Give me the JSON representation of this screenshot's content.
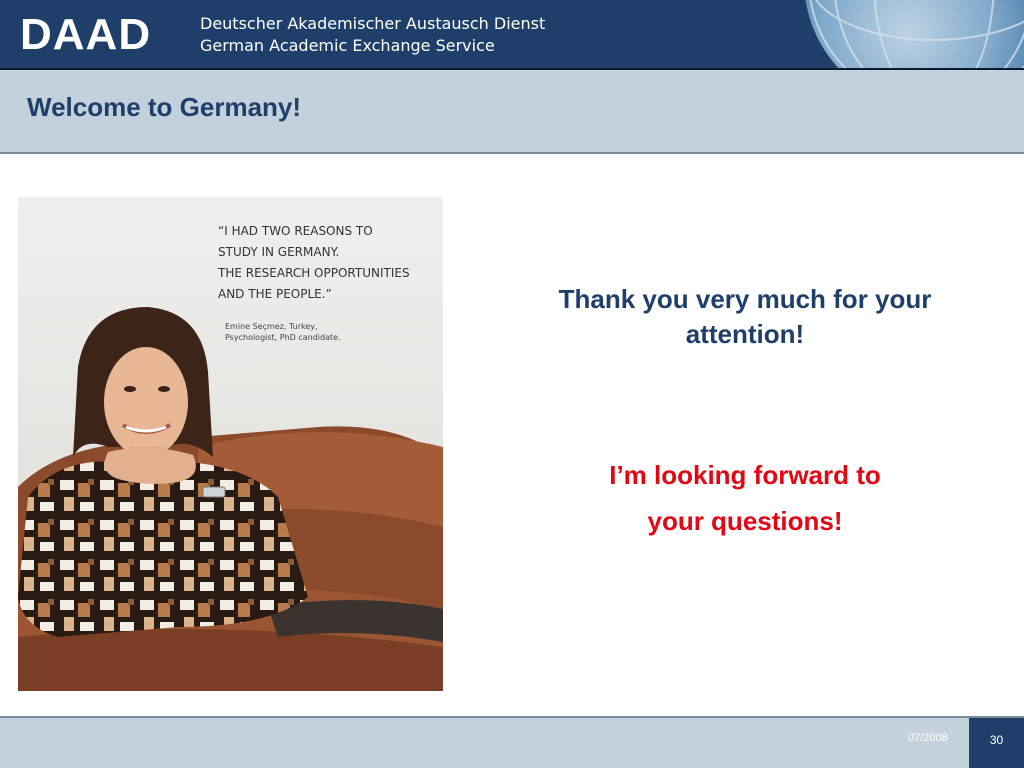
{
  "header": {
    "logo": "DAAD",
    "org_line1": "Deutscher Akademischer Austausch Dienst",
    "org_line2": "German Academic Exchange Service"
  },
  "slide": {
    "title": "Welcome to Germany!",
    "photo_quote": "“I HAD TWO REASONS TO\nSTUDY IN GERMANY.\nTHE RESEARCH OPPORTUNITIES\nAND THE PEOPLE.”",
    "photo_credit": "Emine Seçmez, Turkey,\nPsychologist, PhD candidate.",
    "thank_you_line1": "Thank you very much for your",
    "thank_you_line2": "attention!",
    "questions_line1": "I’m looking forward to",
    "questions_line2": "your questions!"
  },
  "footer": {
    "date": "07/2008",
    "page_number": "30"
  },
  "colors": {
    "brand_blue": "#1f3f6a",
    "band_gray": "#c3d1dc",
    "accent_red": "#e30613"
  }
}
